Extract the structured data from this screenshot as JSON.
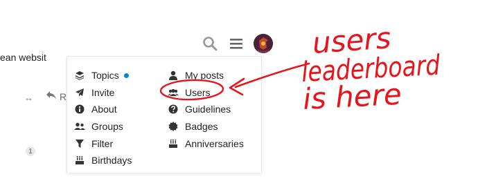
{
  "background": {
    "text_fragment": "ean websit",
    "fold_glyph": "↔",
    "reply_label": "Re",
    "count_badge": "1"
  },
  "header": {
    "icons": [
      "search-icon",
      "hamburger-menu-icon",
      "user-avatar"
    ]
  },
  "menu": {
    "left_items": [
      {
        "label": "Topics",
        "icon": "layers-icon",
        "unread_dot": true
      },
      {
        "label": "Invite",
        "icon": "paper-plane-icon"
      },
      {
        "label": "About",
        "icon": "info-icon"
      },
      {
        "label": "Groups",
        "icon": "groups-icon"
      },
      {
        "label": "Filter",
        "icon": "filter-icon"
      },
      {
        "label": "Birthdays",
        "icon": "birthday-cake-icon"
      }
    ],
    "right_items": [
      {
        "label": "My posts",
        "icon": "user-icon"
      },
      {
        "label": "Users",
        "icon": "users-icon"
      },
      {
        "label": "Guidelines",
        "icon": "question-circle-icon"
      },
      {
        "label": "Badges",
        "icon": "badge-icon"
      },
      {
        "label": "Anniversaries",
        "icon": "anniversary-cake-icon"
      }
    ]
  },
  "annotation": {
    "line1": "users",
    "line2": "leaderboard",
    "line3": "is here",
    "color": "#e8141b"
  },
  "colors": {
    "accent": "#0088cc",
    "icon": "#333333",
    "annotation_red": "#e8141b"
  }
}
